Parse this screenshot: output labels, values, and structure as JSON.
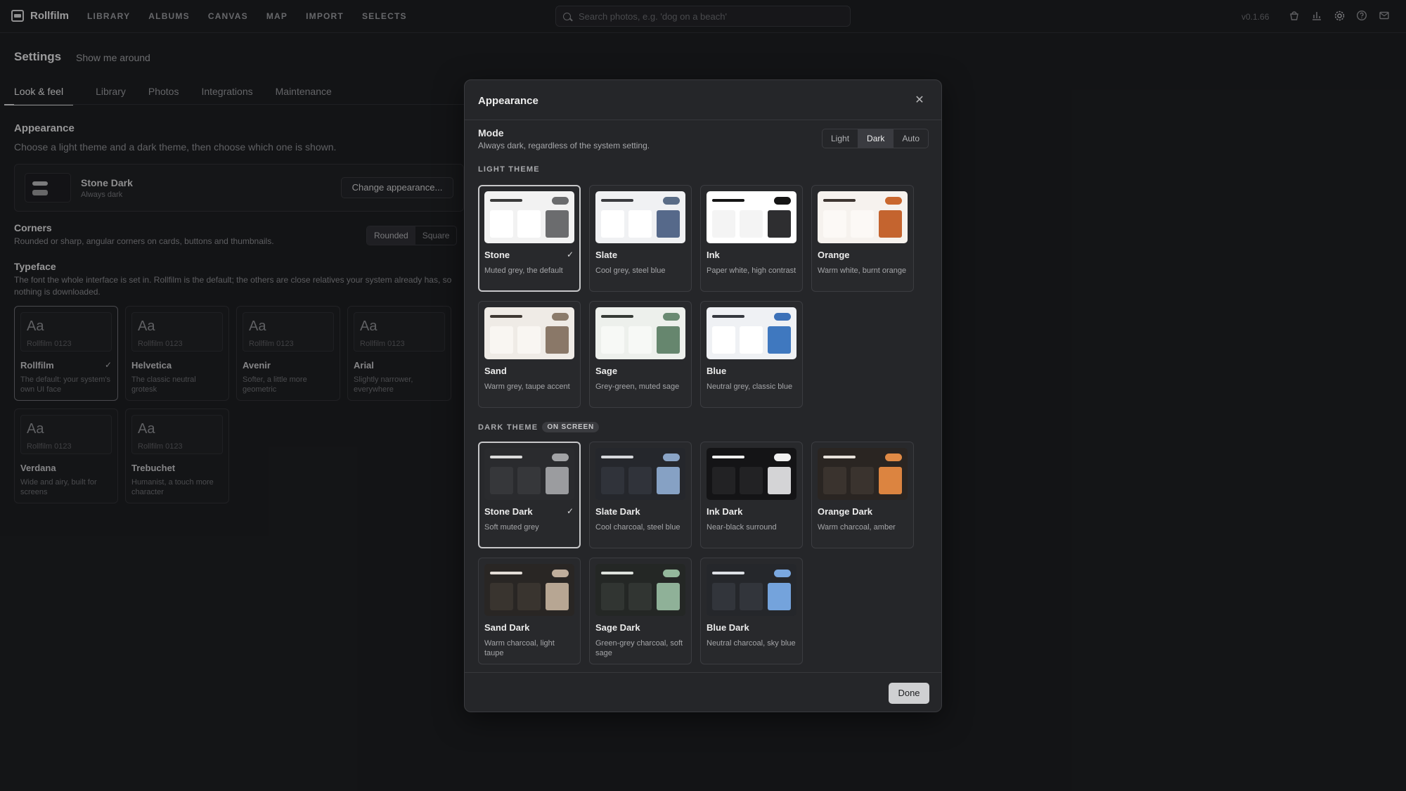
{
  "app": {
    "name": "Rollfilm",
    "version": "v0.1.66"
  },
  "nav": [
    "LIBRARY",
    "ALBUMS",
    "CANVAS",
    "MAP",
    "IMPORT",
    "SELECTS"
  ],
  "search": {
    "placeholder": "Search photos, e.g. 'dog on a beach'"
  },
  "top_icons": [
    "bucket-icon",
    "stats-icon",
    "gear-icon",
    "help-icon",
    "mail-icon"
  ],
  "settings": {
    "title": "Settings",
    "tour": "Show me around",
    "tabs": [
      "Look & feel",
      "Library",
      "Photos",
      "Integrations",
      "Maintenance"
    ],
    "appearance": {
      "heading": "Appearance",
      "desc": "Choose a light theme and a dark theme, then choose which one is shown.",
      "current_name": "Stone Dark",
      "current_sub": "Always dark",
      "button": "Change appearance..."
    },
    "corners": {
      "heading": "Corners",
      "desc": "Rounded or sharp, angular corners on cards, buttons and thumbnails.",
      "options": [
        "Rounded",
        "Square"
      ],
      "selected": "Rounded"
    },
    "typeface": {
      "heading": "Typeface",
      "desc": "The font the whole interface is set in. Rollfilm is the default; the others are close relatives your system already has, so nothing is downloaded.",
      "sample": "Aa",
      "sample_num": "Rollfilm 0123",
      "fonts": [
        {
          "name": "Rollfilm",
          "desc": "The default: your system's own UI face",
          "selected": true
        },
        {
          "name": "Helvetica",
          "desc": "The classic neutral grotesk"
        },
        {
          "name": "Avenir",
          "desc": "Softer, a little more geometric"
        },
        {
          "name": "Arial",
          "desc": "Slightly narrower, everywhere"
        },
        {
          "name": "Verdana",
          "desc": "Wide and airy, built for screens"
        },
        {
          "name": "Trebuchet",
          "desc": "Humanist, a touch more character"
        }
      ]
    }
  },
  "modal": {
    "title": "Appearance",
    "mode": {
      "label": "Mode",
      "desc": "Always dark, regardless of the system setting.",
      "options": [
        "Light",
        "Dark",
        "Auto"
      ],
      "selected": "Dark"
    },
    "light_heading": "LIGHT THEME",
    "dark_heading": "DARK THEME",
    "dark_badge": "ON SCREEN",
    "light_themes": [
      {
        "name": "Stone",
        "desc": "Muted grey, the default",
        "selected": true,
        "bg": "#f2f2f2",
        "bar": "#3a3a3a",
        "pill": "#6a6b6d",
        "p": "#ffffff",
        "accent": "#6b6c6e"
      },
      {
        "name": "Slate",
        "desc": "Cool grey, steel blue",
        "bg": "#f0f1f3",
        "bar": "#3a3b3f",
        "pill": "#5a6c86",
        "p": "#ffffff",
        "accent": "#56698a"
      },
      {
        "name": "Ink",
        "desc": "Paper white, high contrast",
        "bg": "#ffffff",
        "bar": "#151515",
        "pill": "#151515",
        "p": "#f4f4f4",
        "accent": "#2e2e30"
      },
      {
        "name": "Orange",
        "desc": "Warm white, burnt orange",
        "bg": "#f6f2ee",
        "bar": "#3d3530",
        "pill": "#c9672e",
        "p": "#fcf9f6",
        "accent": "#c4642f"
      },
      {
        "name": "Sand",
        "desc": "Warm grey, taupe accent",
        "bg": "#efebe6",
        "bar": "#3e3833",
        "pill": "#8b7b6b",
        "p": "#f9f6f2",
        "accent": "#8a7868"
      },
      {
        "name": "Sage",
        "desc": "Grey-green, muted sage",
        "bg": "#edf0ec",
        "bar": "#353a35",
        "pill": "#6a8a72",
        "p": "#f7f9f6",
        "accent": "#66866e"
      },
      {
        "name": "Blue",
        "desc": "Neutral grey, classic blue",
        "bg": "#eff1f4",
        "bar": "#35383e",
        "pill": "#3c71b8",
        "p": "#ffffff",
        "accent": "#3f78bf"
      }
    ],
    "dark_themes": [
      {
        "name": "Stone Dark",
        "desc": "Soft muted grey",
        "selected": true,
        "bg": "#2a2b2e",
        "bar": "#dcdcdc",
        "pill": "#a2a3a6",
        "p": "#36373a",
        "accent": "#9b9c9f"
      },
      {
        "name": "Slate Dark",
        "desc": "Cool charcoal, steel blue",
        "bg": "#25272c",
        "bar": "#d6d8dc",
        "pill": "#8aa4c6",
        "p": "#30333a",
        "accent": "#86a1c4"
      },
      {
        "name": "Ink Dark",
        "desc": "Near-black surround",
        "bg": "#141416",
        "bar": "#f0f0f0",
        "pill": "#f0f0f0",
        "p": "#222224",
        "accent": "#d4d4d6"
      },
      {
        "name": "Orange Dark",
        "desc": "Warm charcoal, amber",
        "bg": "#2a2522",
        "bar": "#e8e2dc",
        "pill": "#e08a45",
        "p": "#3a332e",
        "accent": "#dc8440"
      },
      {
        "name": "Sand Dark",
        "desc": "Warm charcoal, light taupe",
        "bg": "#292624",
        "bar": "#e4ded8",
        "pill": "#bfae9c",
        "p": "#39342f",
        "accent": "#b7a693"
      },
      {
        "name": "Sage Dark",
        "desc": "Green-grey charcoal, soft sage",
        "bg": "#242725",
        "bar": "#dde2dd",
        "pill": "#94b89c",
        "p": "#313532",
        "accent": "#8fb198"
      },
      {
        "name": "Blue Dark",
        "desc": "Neutral charcoal, sky blue",
        "bg": "#25272b",
        "bar": "#dde0e5",
        "pill": "#7aa8e0",
        "p": "#32353b",
        "accent": "#74a3dc"
      }
    ],
    "done": "Done"
  }
}
